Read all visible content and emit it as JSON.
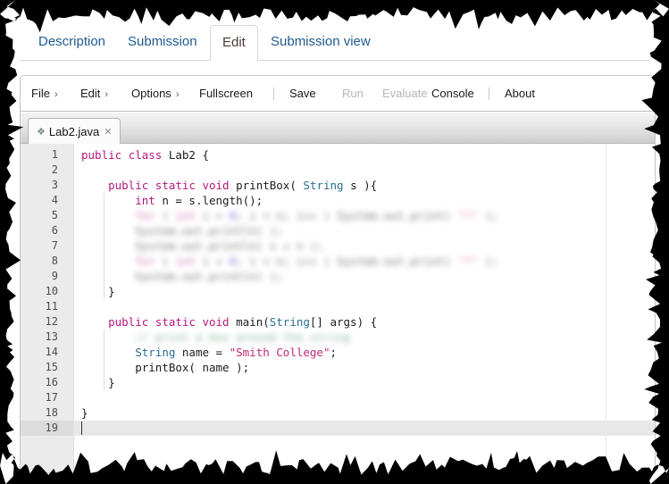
{
  "nav_tabs": [
    {
      "label": "Description",
      "active": false
    },
    {
      "label": "Submission",
      "active": false
    },
    {
      "label": "Edit",
      "active": true
    },
    {
      "label": "Submission view",
      "active": false
    }
  ],
  "menubar": {
    "items": [
      {
        "label": "File",
        "caret": "›",
        "disabled": false
      },
      {
        "label": "Edit",
        "caret": "›",
        "disabled": false
      },
      {
        "label": "Options",
        "caret": "›",
        "disabled": false
      },
      {
        "label": "Fullscreen",
        "caret": "",
        "disabled": false
      },
      {
        "label": "Save",
        "caret": "",
        "disabled": false
      },
      {
        "label": "Run",
        "caret": "",
        "disabled": true
      },
      {
        "label": "Evaluate",
        "caret": "",
        "disabled": true
      },
      {
        "label": "Console",
        "caret": "",
        "disabled": false
      },
      {
        "label": "About",
        "caret": "",
        "disabled": false
      }
    ]
  },
  "file_tab": {
    "name": "Lab2.java",
    "modified_marker": "❖",
    "close_label": "✕"
  },
  "editor": {
    "language": "java",
    "active_line": 19,
    "total_lines": 19,
    "fold_lines": [
      1,
      3,
      12
    ],
    "fold_glyph": "▾",
    "colors": {
      "keyword": "#b3197f",
      "type": "#2b6f8e",
      "string": "#c42a73",
      "plain": "#1c1c1c",
      "gutter_bg": "#ebebeb",
      "active_line_bg": "#e8e8e8",
      "background": "#ffffff"
    },
    "lines": [
      {
        "n": 1,
        "blurred": false,
        "indent": 0,
        "tokens": [
          {
            "t": "public",
            "c": "kw"
          },
          {
            "t": " ",
            "c": "pln"
          },
          {
            "t": "class",
            "c": "kw"
          },
          {
            "t": " Lab2 {",
            "c": "pln"
          }
        ]
      },
      {
        "n": 2,
        "blurred": false,
        "indent": 0,
        "tokens": []
      },
      {
        "n": 3,
        "blurred": false,
        "indent": 4,
        "tokens": [
          {
            "t": "    ",
            "c": "pln"
          },
          {
            "t": "public",
            "c": "kw"
          },
          {
            "t": " ",
            "c": "pln"
          },
          {
            "t": "static",
            "c": "kw"
          },
          {
            "t": " ",
            "c": "pln"
          },
          {
            "t": "void",
            "c": "kw"
          },
          {
            "t": " printBox( ",
            "c": "pln"
          },
          {
            "t": "String",
            "c": "typ"
          },
          {
            "t": " s ){",
            "c": "pln"
          }
        ]
      },
      {
        "n": 4,
        "blurred": false,
        "indent": 8,
        "tokens": [
          {
            "t": "        ",
            "c": "pln"
          },
          {
            "t": "int",
            "c": "kw"
          },
          {
            "t": " n = s.length();",
            "c": "pln"
          }
        ]
      },
      {
        "n": 5,
        "blurred": true,
        "indent": 8,
        "tokens": [
          {
            "t": "        ",
            "c": "pln"
          },
          {
            "t": "for",
            "c": "kw"
          },
          {
            "t": " ( ",
            "c": "pln"
          },
          {
            "t": "int",
            "c": "kw"
          },
          {
            "t": " i = ",
            "c": "pln"
          },
          {
            "t": "0",
            "c": "num"
          },
          {
            "t": "; i < n; i++ ) System.out.print( ",
            "c": "pln"
          },
          {
            "t": "\"*\"",
            "c": "str"
          },
          {
            "t": " );",
            "c": "pln"
          }
        ]
      },
      {
        "n": 6,
        "blurred": true,
        "indent": 8,
        "tokens": [
          {
            "t": "        System.out.println( );",
            "c": "pln"
          }
        ]
      },
      {
        "n": 7,
        "blurred": true,
        "indent": 8,
        "tokens": [
          {
            "t": "        System.out.println( s + n );",
            "c": "pln"
          }
        ]
      },
      {
        "n": 8,
        "blurred": true,
        "indent": 8,
        "tokens": [
          {
            "t": "        ",
            "c": "pln"
          },
          {
            "t": "for",
            "c": "kw"
          },
          {
            "t": " ( ",
            "c": "pln"
          },
          {
            "t": "int",
            "c": "kw"
          },
          {
            "t": " i = ",
            "c": "pln"
          },
          {
            "t": "0",
            "c": "num"
          },
          {
            "t": "; i < n; i++ ) System.out.print( ",
            "c": "pln"
          },
          {
            "t": "\"*\"",
            "c": "str"
          },
          {
            "t": " );",
            "c": "pln"
          }
        ]
      },
      {
        "n": 9,
        "blurred": true,
        "indent": 8,
        "tokens": [
          {
            "t": "        System.out.println( );",
            "c": "pln"
          }
        ]
      },
      {
        "n": 10,
        "blurred": false,
        "indent": 4,
        "tokens": [
          {
            "t": "    }",
            "c": "pln"
          }
        ]
      },
      {
        "n": 11,
        "blurred": false,
        "indent": 0,
        "tokens": []
      },
      {
        "n": 12,
        "blurred": false,
        "indent": 4,
        "tokens": [
          {
            "t": "    ",
            "c": "pln"
          },
          {
            "t": "public",
            "c": "kw"
          },
          {
            "t": " ",
            "c": "pln"
          },
          {
            "t": "static",
            "c": "kw"
          },
          {
            "t": " ",
            "c": "pln"
          },
          {
            "t": "void",
            "c": "kw"
          },
          {
            "t": " main(",
            "c": "pln"
          },
          {
            "t": "String",
            "c": "typ"
          },
          {
            "t": "[] args) {",
            "c": "pln"
          }
        ]
      },
      {
        "n": 13,
        "blurred": true,
        "indent": 8,
        "tokens": [
          {
            "t": "        // print a box around the string",
            "c": "cmt"
          }
        ]
      },
      {
        "n": 14,
        "blurred": false,
        "indent": 8,
        "tokens": [
          {
            "t": "        ",
            "c": "pln"
          },
          {
            "t": "String",
            "c": "typ"
          },
          {
            "t": " name = ",
            "c": "pln"
          },
          {
            "t": "\"Smith College\"",
            "c": "str"
          },
          {
            "t": ";",
            "c": "pln"
          }
        ]
      },
      {
        "n": 15,
        "blurred": false,
        "indent": 8,
        "tokens": [
          {
            "t": "        printBox( name );",
            "c": "pln"
          }
        ]
      },
      {
        "n": 16,
        "blurred": false,
        "indent": 4,
        "tokens": [
          {
            "t": "    }",
            "c": "pln"
          }
        ]
      },
      {
        "n": 17,
        "blurred": false,
        "indent": 0,
        "tokens": []
      },
      {
        "n": 18,
        "blurred": false,
        "indent": 0,
        "tokens": [
          {
            "t": "}",
            "c": "pln"
          }
        ]
      },
      {
        "n": 19,
        "blurred": false,
        "indent": 0,
        "tokens": []
      }
    ]
  }
}
